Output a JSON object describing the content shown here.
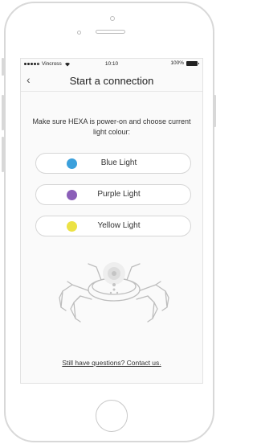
{
  "status_bar": {
    "carrier": "Vincross",
    "time": "10:10",
    "battery": "100%"
  },
  "nav": {
    "back_icon": "chevron-left-icon",
    "title": "Start a connection"
  },
  "instructions": "Make sure HEXA is power-on and choose current light colour:",
  "light_options": [
    {
      "label": "Blue Light",
      "color": "#3ba0dc"
    },
    {
      "label": "Purple Light",
      "color": "#8b5fb8"
    },
    {
      "label": "Yellow Light",
      "color": "#ece245"
    }
  ],
  "contact_link": "Still have questions? Contact us.",
  "colors": {
    "accent_blue": "#3ba0dc",
    "accent_purple": "#8b5fb8",
    "accent_yellow": "#ece245"
  }
}
